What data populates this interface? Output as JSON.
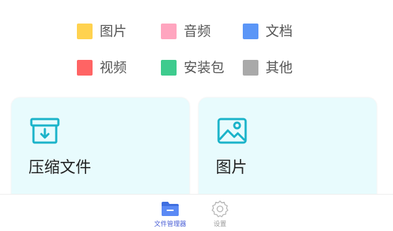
{
  "legend": {
    "items": [
      {
        "label": "图片",
        "color": "#ffd24f"
      },
      {
        "label": "音频",
        "color": "#ffa5bf"
      },
      {
        "label": "文档",
        "color": "#5b96f7"
      },
      {
        "label": "视频",
        "color": "#ff6464"
      },
      {
        "label": "安装包",
        "color": "#3ecb8e"
      },
      {
        "label": "其他",
        "color": "#a9a9a9"
      }
    ]
  },
  "cards": [
    {
      "label": "压缩文件",
      "icon": "archive-icon"
    },
    {
      "label": "图片",
      "icon": "image-icon"
    }
  ],
  "tabbar": {
    "tabs": [
      {
        "label": "文件管理器",
        "icon": "folder-icon",
        "active": true
      },
      {
        "label": "设置",
        "icon": "gear-icon",
        "active": false
      }
    ]
  },
  "colors": {
    "card_bg": "#e8fbfd",
    "card_icon": "#1ab3c9",
    "accent": "#4a5fd6"
  }
}
